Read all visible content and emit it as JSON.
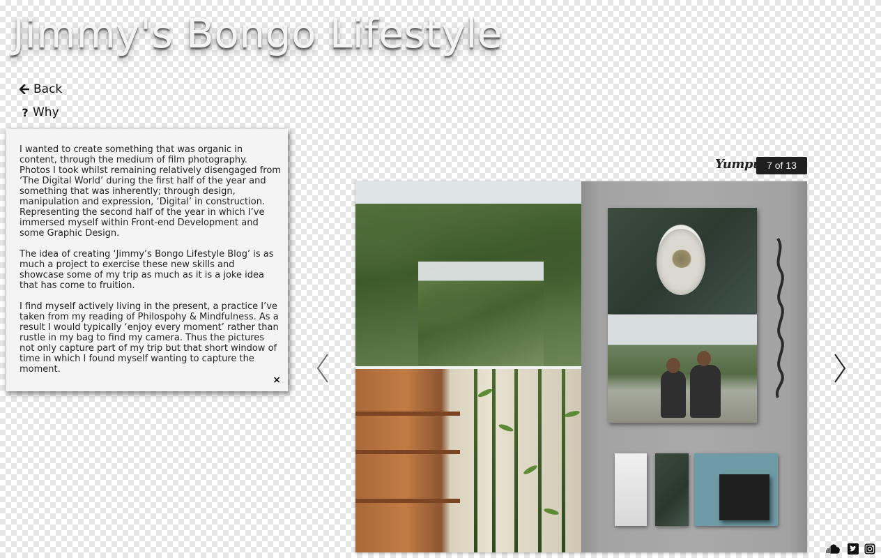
{
  "site": {
    "title": "Jimmy's Bongo Lifestyle"
  },
  "nav": {
    "back_label": "Back",
    "why_label": "Why",
    "back_icon": "arrow-left-icon",
    "why_icon": "question-icon"
  },
  "why_panel": {
    "paragraphs": [
      "I wanted to create something that was organic in content, through the medium of film photography. Photos I took whilst remaining relatively disengaged from ‘The Digital World’ during the first half of the year and something that was inherently; through design, manipulation and expression, ‘Digital’ in construction. Representing the second half of the year in which I’ve immersed myself within Front-end Development and some Graphic Design.",
      "The idea of creating ‘Jimmy’s Bongo Lifestyle Blog’ is as much a project to exercise these new skills and showcase some of my trip as much as it is a joke idea that has come to fruition.",
      "I find myself actively living in the present, a practice I’ve taken from my reading of Philospohy & Mindfulness. As a result I would typically ‘enjoy every moment’ rather than rustle in my bag to find my camera. Thus the pictures not only capture part of my trip but that short window of time in which I found myself wanting to capture the moment."
    ],
    "close_symbol": "×"
  },
  "viewer": {
    "brand": "Yumpu",
    "page_counter": "7 of 13",
    "current_page": 7,
    "total_pages": 13,
    "prev_icon": "chevron-left-icon",
    "next_icon": "chevron-right-icon"
  },
  "social": {
    "icons": [
      "soundcloud-icon",
      "twitter-icon",
      "instagram-icon"
    ]
  },
  "colors": {
    "title_text": "#f4f4f4",
    "panel_bg": "#f4f4f4",
    "counter_bg": "#1f1f1f",
    "page_gray": "#a9a9a9"
  }
}
